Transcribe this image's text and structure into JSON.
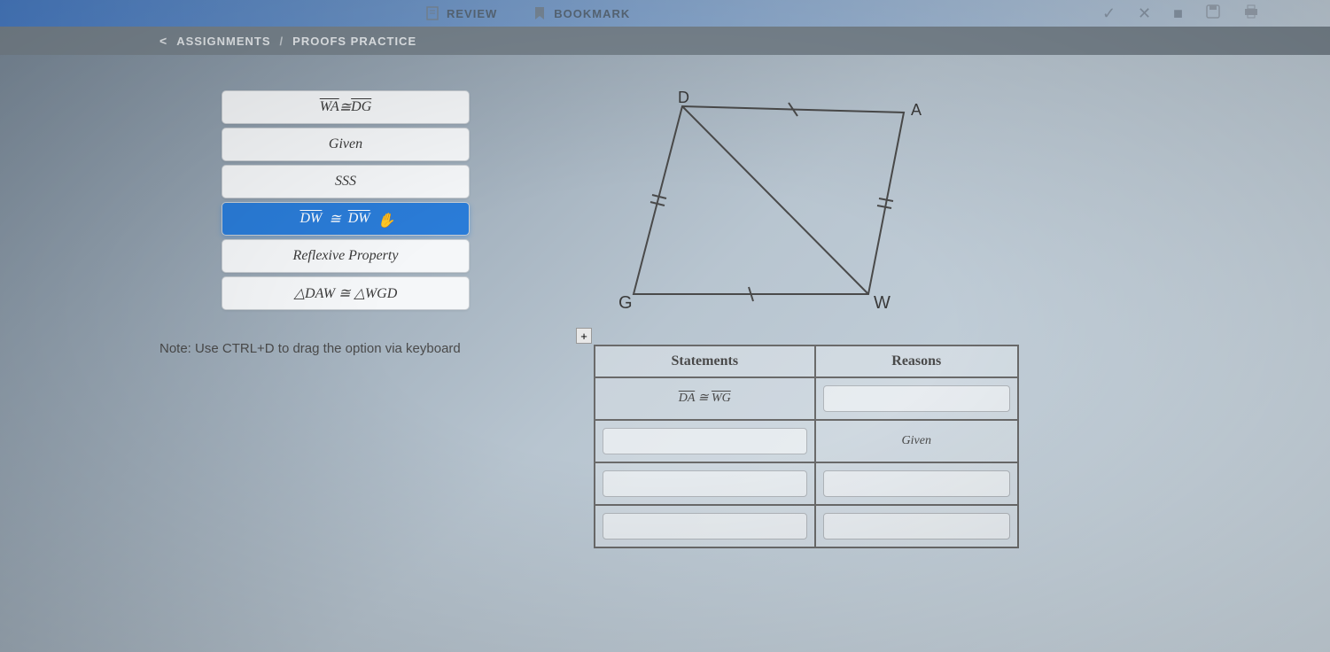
{
  "tabs": {
    "review": "REVIEW",
    "bookmark": "BOOKMARK"
  },
  "breadcrumb": {
    "back": "ASSIGNMENTS",
    "current": "PROOFS PRACTICE"
  },
  "options": [
    {
      "html": "<span class='overline'>WA</span> ≅ <span class='overline'>DG</span>",
      "selected": false,
      "name": "option-wa-dg"
    },
    {
      "html": "Given",
      "selected": false,
      "name": "option-given"
    },
    {
      "html": "SSS",
      "selected": false,
      "name": "option-sss"
    },
    {
      "html": "<span class='overline'>DW</span>&nbsp; ≅ &nbsp;<span class='overline'>DW</span>",
      "selected": true,
      "name": "option-dw-dw"
    },
    {
      "html": "Reflexive Property",
      "selected": false,
      "name": "option-reflexive"
    },
    {
      "html": "△DAW ≅ △WGD",
      "selected": false,
      "name": "option-triangles"
    }
  ],
  "note": "Note: Use CTRL+D to drag the option via keyboard",
  "diagram": {
    "vertices": {
      "D": "D",
      "A": "A",
      "G": "G",
      "W": "W"
    }
  },
  "proof_table": {
    "headers": {
      "statements": "Statements",
      "reasons": "Reasons"
    },
    "rows": [
      {
        "statement_html": "<span class='overline'>DA</span> ≅ <span class='overline'>WG</span>",
        "reason_html": "",
        "stmt_slot": false,
        "rsn_slot": true
      },
      {
        "statement_html": "",
        "reason_html": "Given",
        "stmt_slot": true,
        "rsn_slot": false
      },
      {
        "statement_html": "",
        "reason_html": "",
        "stmt_slot": true,
        "rsn_slot": true
      },
      {
        "statement_html": "",
        "reason_html": "",
        "stmt_slot": true,
        "rsn_slot": true
      }
    ]
  },
  "plus": "+"
}
